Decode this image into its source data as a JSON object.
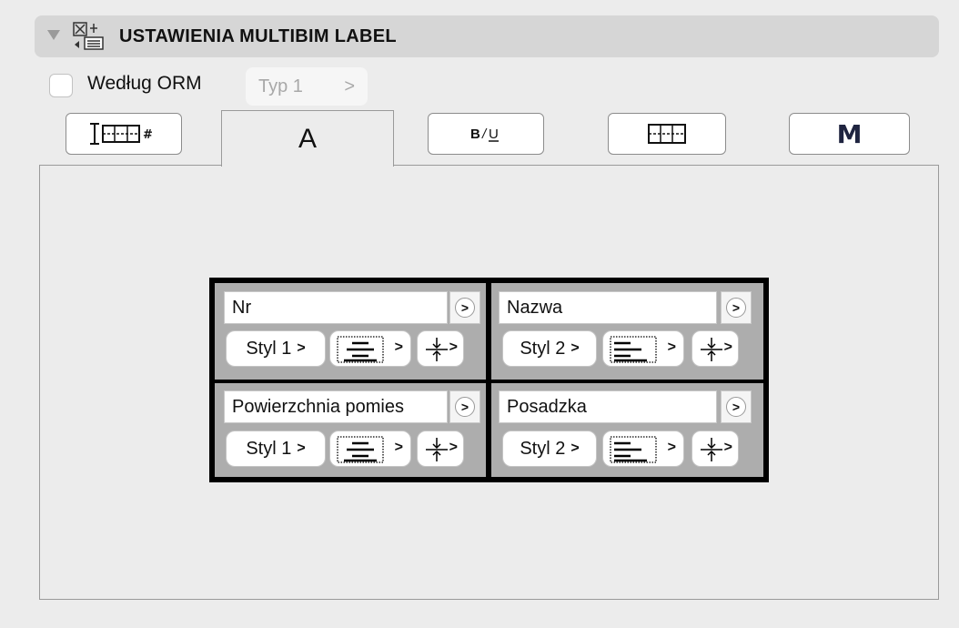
{
  "header": {
    "title": "USTAWIENIA MULTIBIM LABEL"
  },
  "options": {
    "by_orm_label": "Według ORM",
    "type_value": "Typ 1",
    "type_chevron": ">"
  },
  "tabs": [
    {
      "name": "columns-tab",
      "label": ""
    },
    {
      "name": "text-tab",
      "label": "A"
    },
    {
      "name": "format-tab",
      "label": "B / U"
    },
    {
      "name": "table-tab",
      "label": ""
    },
    {
      "name": "m-tab",
      "label": "M"
    }
  ],
  "cells": [
    {
      "field": "Nr",
      "style": "Styl 1",
      "align": "center"
    },
    {
      "field": "Nazwa",
      "style": "Styl 2",
      "align": "left"
    },
    {
      "field": "Powierzchnia pomies",
      "style": "Styl 1",
      "align": "center"
    },
    {
      "field": "Posadzka",
      "style": "Styl 2",
      "align": "left"
    }
  ],
  "chevron": ">",
  "colors": {
    "background": "#ececec",
    "header": "#d6d6d6",
    "cell": "#adadad",
    "grid_border": "#000000"
  }
}
